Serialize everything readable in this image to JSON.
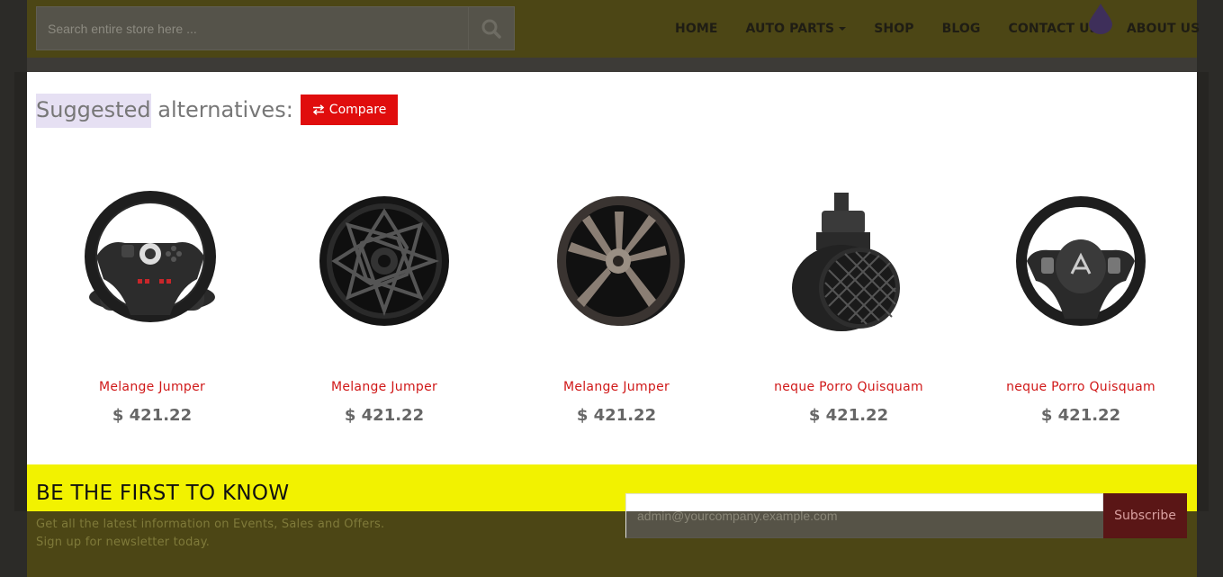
{
  "header": {
    "search_placeholder": "Search entire store here ...",
    "nav": [
      "HOME",
      "AUTO PARTS",
      "SHOP",
      "BLOG",
      "CONTACT US",
      "ABOUT US"
    ]
  },
  "modal": {
    "title_highlight": "Suggested",
    "title_rest": "alternatives:",
    "compare_label": "Compare",
    "products": [
      {
        "name": "Melange Jumper",
        "price": "$ 421.22",
        "icon": "steering-wheel-gaming"
      },
      {
        "name": "Melange Jumper",
        "price": "$ 421.22",
        "icon": "alloy-wheel-mesh"
      },
      {
        "name": "Melange Jumper",
        "price": "$ 421.22",
        "icon": "alloy-wheel-spoke"
      },
      {
        "name": "neque Porro Quisquam",
        "price": "$ 421.22",
        "icon": "air-flow-sensor"
      },
      {
        "name": "neque Porro Quisquam",
        "price": "$ 421.22",
        "icon": "steering-wheel-car"
      }
    ]
  },
  "newsletter": {
    "title": "BE THE FIRST TO KNOW",
    "line1": "Get all the latest information on Events, Sales and Offers.",
    "line2": "Sign up for newsletter today.",
    "email_placeholder": "admin@yourcompany.example.com",
    "subscribe_label": "Subscribe"
  },
  "colors": {
    "accent_red": "#e00d0d",
    "product_name": "#d01818",
    "newsletter_bg": "#f2f200",
    "header_bg": "#4c4615"
  }
}
